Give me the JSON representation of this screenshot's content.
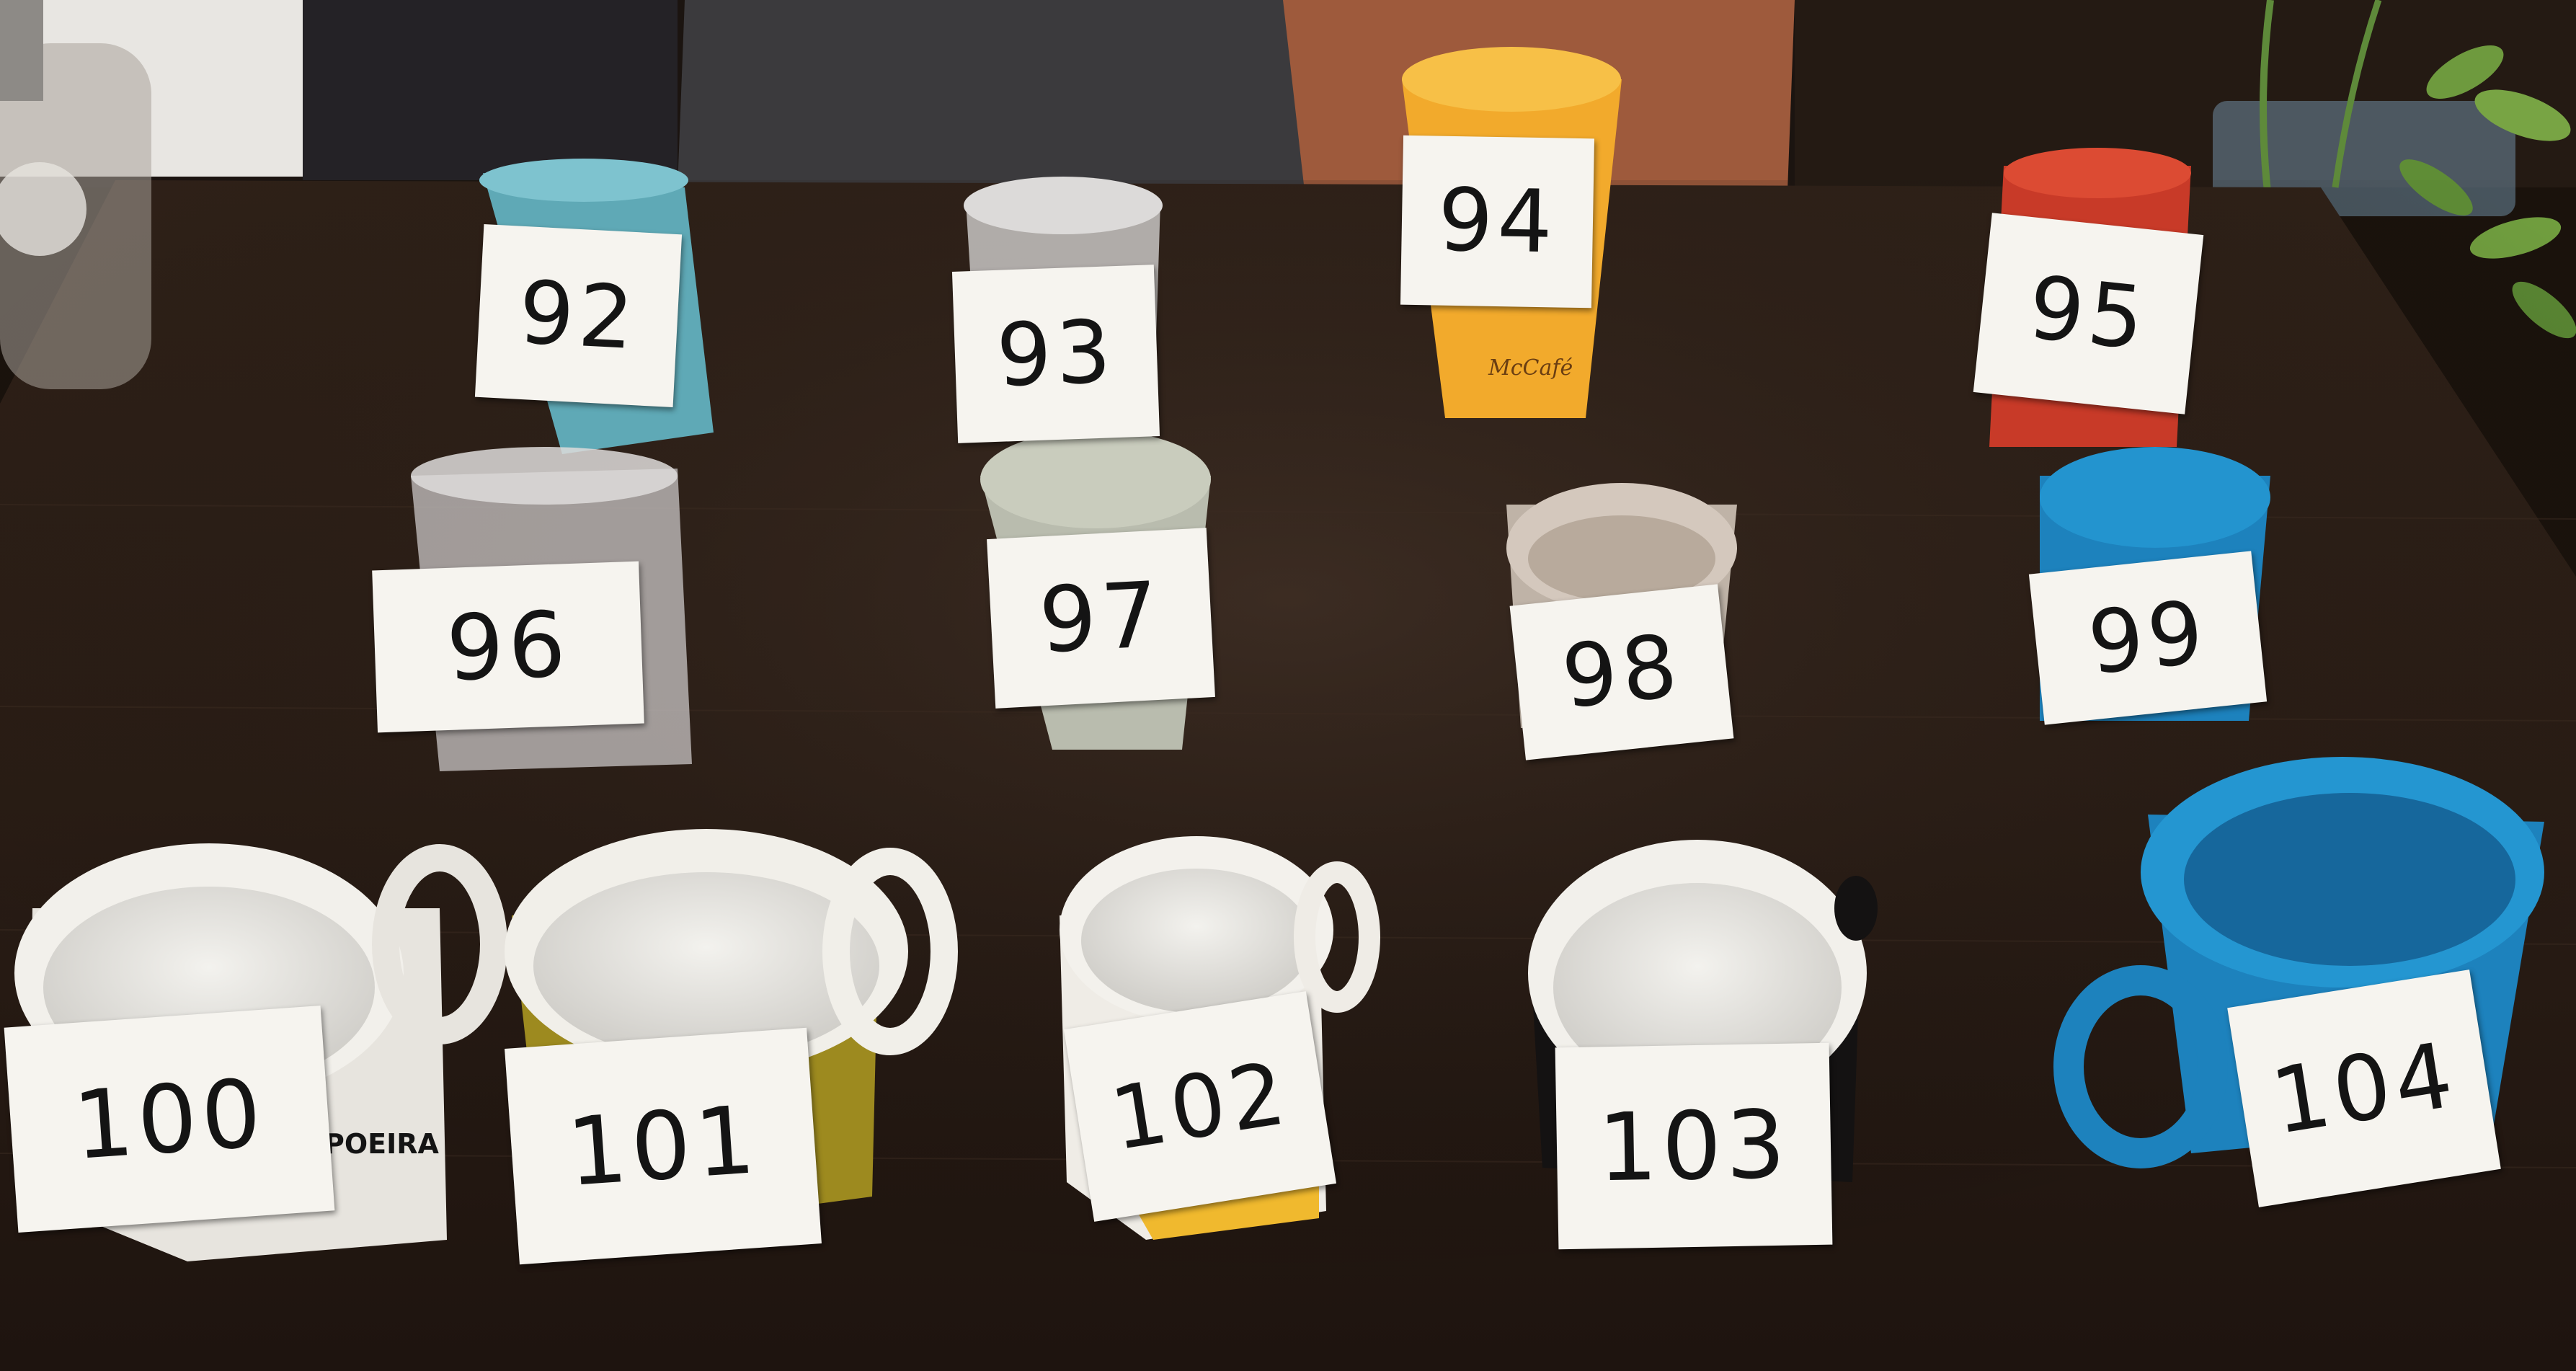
{
  "colors": {
    "table": "#2a1d15",
    "wall_left": "#e8e6e2",
    "chair_gray": "#3b3a3d",
    "sweater_rust": "#9e5a3c",
    "cup_light_blue": "#6db3c0",
    "cup_yellow": "#f2aa2c",
    "cup_red": "#c83a28",
    "mug_blue": "#1d82bd",
    "mug_olive": "#9d8a1f",
    "label_paper": "#f6f4ef",
    "ink": "#141414"
  },
  "print_text": {
    "mccafe_cup": "McCafé",
    "capoeira_mug": "POEIRA"
  },
  "labels": [
    {
      "id": "92",
      "text": "92"
    },
    {
      "id": "93",
      "text": "93"
    },
    {
      "id": "94",
      "text": "94"
    },
    {
      "id": "95",
      "text": "95"
    },
    {
      "id": "96",
      "text": "96"
    },
    {
      "id": "97",
      "text": "97"
    },
    {
      "id": "98",
      "text": "98"
    },
    {
      "id": "99",
      "text": "99"
    },
    {
      "id": "100",
      "text": "100"
    },
    {
      "id": "101",
      "text": "101"
    },
    {
      "id": "102",
      "text": "102"
    },
    {
      "id": "103",
      "text": "103"
    },
    {
      "id": "104",
      "text": "104"
    }
  ]
}
